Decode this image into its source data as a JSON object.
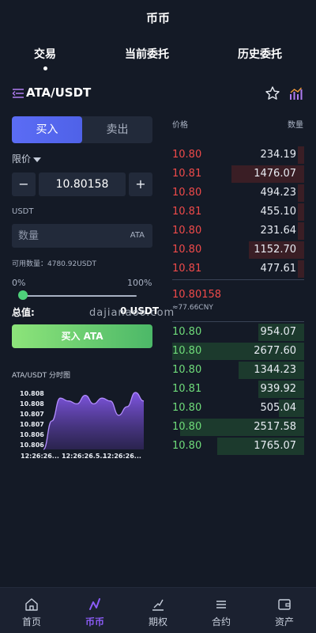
{
  "header": {
    "title": "币币"
  },
  "tabs": [
    {
      "label": "交易",
      "active": true
    },
    {
      "label": "当前委托",
      "active": false
    },
    {
      "label": "历史委托",
      "active": false
    }
  ],
  "pair": {
    "name": "ATA/USDT",
    "icons": [
      "menu-collapse-icon",
      "star-icon",
      "chart-bars-icon"
    ]
  },
  "trade": {
    "buy_label": "买入",
    "sell_label": "卖出",
    "order_type": "限价",
    "minus": "−",
    "plus": "+",
    "price_value": "10.80158",
    "unit_label": "USDT",
    "qty_placeholder": "数量",
    "qty_unit": "ATA",
    "available": "可用数量：4780.92USDT",
    "pct_min": "0%",
    "pct_max": "100%",
    "slider_fraction": 0,
    "total_label": "总值:",
    "total_value": "0 USDT",
    "submit_label": "买入 ATA"
  },
  "mini_chart": {
    "title": "ATA/USDT 分时图",
    "y_ticks": [
      "10.808",
      "10.808",
      "10.807",
      "10.807",
      "10.806",
      "10.806"
    ],
    "x_ticks": [
      "12:26:26...",
      "12:26:26.5...",
      "12:26:26..."
    ],
    "values": [
      10.8061,
      10.8071,
      10.8079,
      10.8078,
      10.8077,
      10.808,
      10.8077,
      10.8079,
      10.8078,
      10.8073,
      10.8076,
      10.8081,
      10.8078
    ]
  },
  "orderbook": {
    "price_header": "价格",
    "qty_header": "数量",
    "asks": [
      {
        "price": "10.80",
        "qty": "234.19",
        "depth": 0.05
      },
      {
        "price": "10.81",
        "qty": "1476.07",
        "depth": 0.55
      },
      {
        "price": "10.80",
        "qty": "494.23",
        "depth": 0.05
      },
      {
        "price": "10.81",
        "qty": "455.10",
        "depth": 0.05
      },
      {
        "price": "10.80",
        "qty": "231.64",
        "depth": 0.05
      },
      {
        "price": "10.80",
        "qty": "1152.70",
        "depth": 0.42
      },
      {
        "price": "10.81",
        "qty": "477.61",
        "depth": 0.05
      }
    ],
    "last_price": "10.80158",
    "last_cny": "≈77.66CNY",
    "bids": [
      {
        "price": "10.80",
        "qty": "954.07",
        "depth": 0.35
      },
      {
        "price": "10.80",
        "qty": "2677.60",
        "depth": 1.0
      },
      {
        "price": "10.80",
        "qty": "1344.23",
        "depth": 0.5
      },
      {
        "price": "10.81",
        "qty": "939.92",
        "depth": 0.35
      },
      {
        "price": "10.80",
        "qty": "505.04",
        "depth": 0.19
      },
      {
        "price": "10.80",
        "qty": "2517.58",
        "depth": 0.94
      },
      {
        "price": "10.80",
        "qty": "1765.07",
        "depth": 0.66
      }
    ]
  },
  "watermark": "dajianaoo.com",
  "nav": [
    {
      "label": "首页",
      "icon": "home-icon",
      "active": false
    },
    {
      "label": "币币",
      "icon": "coin-trade-icon",
      "active": true
    },
    {
      "label": "期权",
      "icon": "options-icon",
      "active": false
    },
    {
      "label": "合约",
      "icon": "contract-icon",
      "active": false
    },
    {
      "label": "资产",
      "icon": "wallet-icon",
      "active": false
    }
  ],
  "colors": {
    "accent": "#8b5cf6",
    "buy": "#4f62e8",
    "ask": "#ef4a4a",
    "bid": "#6fdc7a",
    "bg": "#141a26"
  }
}
